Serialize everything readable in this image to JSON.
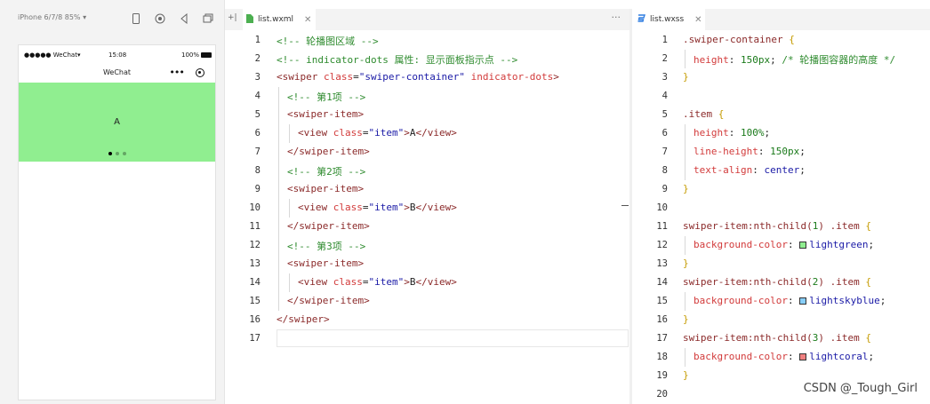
{
  "simulator": {
    "device_label": "iPhone 6/7/8 85% ▾",
    "toolbar_icons": [
      "phone-icon",
      "record-icon",
      "back-icon",
      "window-icon",
      "split-icon"
    ],
    "status": {
      "carrier": "●●●●● WeChat▾",
      "time": "15:08",
      "battery": "100%"
    },
    "nav_title": "WeChat",
    "capsule_dots": "•••",
    "swiper": {
      "current_item": "A",
      "background": "#90ee90",
      "dots_total": 3,
      "dots_active": 1
    }
  },
  "editor_wxml": {
    "split_label": "+|",
    "tab_label": "list.wxml",
    "more_label": "···",
    "lines": [
      {
        "n": "1",
        "indent": 0,
        "parts": [
          [
            "c-comment",
            "<!-- 轮播图区域 -->"
          ]
        ]
      },
      {
        "n": "2",
        "indent": 0,
        "parts": [
          [
            "c-comment",
            "<!-- indicator-dots 属性: 显示面板指示点 -->"
          ]
        ]
      },
      {
        "n": "3",
        "indent": 0,
        "parts": [
          [
            "c-tag",
            "<swiper "
          ],
          [
            "c-attr",
            "class"
          ],
          [
            "c-plain",
            "="
          ],
          [
            "c-str",
            "\"swiper-container\""
          ],
          [
            "c-plain",
            " "
          ],
          [
            "c-attr",
            "indicator-dots"
          ],
          [
            "c-tag",
            ">"
          ]
        ]
      },
      {
        "n": "4",
        "indent": 1,
        "parts": [
          [
            "c-comment",
            "<!-- 第1项 -->"
          ]
        ]
      },
      {
        "n": "5",
        "indent": 1,
        "parts": [
          [
            "c-tag",
            "<swiper-item>"
          ]
        ]
      },
      {
        "n": "6",
        "indent": 2,
        "parts": [
          [
            "c-tag",
            "<view "
          ],
          [
            "c-attr",
            "class"
          ],
          [
            "c-plain",
            "="
          ],
          [
            "c-str",
            "\"item\""
          ],
          [
            "c-tag",
            ">"
          ],
          [
            "c-plain",
            "A"
          ],
          [
            "c-tag",
            "</view>"
          ]
        ]
      },
      {
        "n": "7",
        "indent": 1,
        "parts": [
          [
            "c-tag",
            "</swiper-item>"
          ]
        ]
      },
      {
        "n": "8",
        "indent": 1,
        "parts": [
          [
            "c-comment",
            "<!-- 第2项 -->"
          ]
        ]
      },
      {
        "n": "9",
        "indent": 1,
        "parts": [
          [
            "c-tag",
            "<swiper-item>"
          ]
        ]
      },
      {
        "n": "10",
        "indent": 2,
        "parts": [
          [
            "c-tag",
            "<view "
          ],
          [
            "c-attr",
            "class"
          ],
          [
            "c-plain",
            "="
          ],
          [
            "c-str",
            "\"item\""
          ],
          [
            "c-tag",
            ">"
          ],
          [
            "c-plain",
            "B"
          ],
          [
            "c-tag",
            "</view>"
          ]
        ]
      },
      {
        "n": "11",
        "indent": 1,
        "parts": [
          [
            "c-tag",
            "</swiper-item>"
          ]
        ]
      },
      {
        "n": "12",
        "indent": 1,
        "parts": [
          [
            "c-comment",
            "<!-- 第3项 -->"
          ]
        ]
      },
      {
        "n": "13",
        "indent": 1,
        "parts": [
          [
            "c-tag",
            "<swiper-item>"
          ]
        ]
      },
      {
        "n": "14",
        "indent": 2,
        "parts": [
          [
            "c-tag",
            "<view "
          ],
          [
            "c-attr",
            "class"
          ],
          [
            "c-plain",
            "="
          ],
          [
            "c-str",
            "\"item\""
          ],
          [
            "c-tag",
            ">"
          ],
          [
            "c-plain",
            "B"
          ],
          [
            "c-tag",
            "</view>"
          ]
        ]
      },
      {
        "n": "15",
        "indent": 1,
        "parts": [
          [
            "c-tag",
            "</swiper-item>"
          ]
        ]
      },
      {
        "n": "16",
        "indent": 0,
        "parts": [
          [
            "c-tag",
            "</swiper>"
          ]
        ]
      },
      {
        "n": "17",
        "indent": 0,
        "parts": []
      }
    ]
  },
  "editor_wxss": {
    "tab_label": "list.wxss",
    "lines": [
      {
        "n": "1",
        "indent": 0,
        "parts": [
          [
            "c-sel",
            ".swiper-container "
          ],
          [
            "c-brace",
            "{"
          ]
        ]
      },
      {
        "n": "2",
        "indent": 1,
        "parts": [
          [
            "c-prop",
            "height"
          ],
          [
            "c-plain",
            ": "
          ],
          [
            "c-num",
            "150px"
          ],
          [
            "c-plain",
            "; "
          ],
          [
            "c-comment",
            "/* 轮播图容器的高度 */"
          ]
        ]
      },
      {
        "n": "3",
        "indent": 0,
        "parts": [
          [
            "c-brace",
            "}"
          ]
        ]
      },
      {
        "n": "4",
        "indent": 0,
        "parts": []
      },
      {
        "n": "5",
        "indent": 0,
        "parts": [
          [
            "c-sel",
            ".item "
          ],
          [
            "c-brace",
            "{"
          ]
        ]
      },
      {
        "n": "6",
        "indent": 1,
        "parts": [
          [
            "c-prop",
            "height"
          ],
          [
            "c-plain",
            ": "
          ],
          [
            "c-num",
            "100%"
          ],
          [
            "c-plain",
            ";"
          ]
        ]
      },
      {
        "n": "7",
        "indent": 1,
        "parts": [
          [
            "c-prop",
            "line-height"
          ],
          [
            "c-plain",
            ": "
          ],
          [
            "c-num",
            "150px"
          ],
          [
            "c-plain",
            ";"
          ]
        ]
      },
      {
        "n": "8",
        "indent": 1,
        "parts": [
          [
            "c-prop",
            "text-align"
          ],
          [
            "c-plain",
            ": "
          ],
          [
            "c-val",
            "center"
          ],
          [
            "c-plain",
            ";"
          ]
        ]
      },
      {
        "n": "9",
        "indent": 0,
        "parts": [
          [
            "c-brace",
            "}"
          ]
        ]
      },
      {
        "n": "10",
        "indent": 0,
        "parts": []
      },
      {
        "n": "11",
        "indent": 0,
        "parts": [
          [
            "c-sel",
            "swiper-item:nth-child("
          ],
          [
            "c-num",
            "1"
          ],
          [
            "c-sel",
            ") .item "
          ],
          [
            "c-brace",
            "{"
          ]
        ]
      },
      {
        "n": "12",
        "indent": 1,
        "parts": [
          [
            "c-prop",
            "background-color"
          ],
          [
            "c-plain",
            ": "
          ],
          [
            "swatch",
            "#90ee90"
          ],
          [
            "c-val",
            "lightgreen"
          ],
          [
            "c-plain",
            ";"
          ]
        ]
      },
      {
        "n": "13",
        "indent": 0,
        "parts": [
          [
            "c-brace",
            "}"
          ]
        ]
      },
      {
        "n": "14",
        "indent": 0,
        "parts": [
          [
            "c-sel",
            "swiper-item:nth-child("
          ],
          [
            "c-num",
            "2"
          ],
          [
            "c-sel",
            ") .item "
          ],
          [
            "c-brace",
            "{"
          ]
        ]
      },
      {
        "n": "15",
        "indent": 1,
        "parts": [
          [
            "c-prop",
            "background-color"
          ],
          [
            "c-plain",
            ": "
          ],
          [
            "swatch",
            "#87cefa"
          ],
          [
            "c-val",
            "lightskyblue"
          ],
          [
            "c-plain",
            ";"
          ]
        ]
      },
      {
        "n": "16",
        "indent": 0,
        "parts": [
          [
            "c-brace",
            "}"
          ]
        ]
      },
      {
        "n": "17",
        "indent": 0,
        "parts": [
          [
            "c-sel",
            "swiper-item:nth-child("
          ],
          [
            "c-num",
            "3"
          ],
          [
            "c-sel",
            ") .item "
          ],
          [
            "c-brace",
            "{"
          ]
        ]
      },
      {
        "n": "18",
        "indent": 1,
        "parts": [
          [
            "c-prop",
            "background-color"
          ],
          [
            "c-plain",
            ": "
          ],
          [
            "swatch",
            "#f08080"
          ],
          [
            "c-val",
            "lightcoral"
          ],
          [
            "c-plain",
            ";"
          ]
        ]
      },
      {
        "n": "19",
        "indent": 0,
        "parts": [
          [
            "c-brace",
            "}"
          ]
        ]
      },
      {
        "n": "20",
        "indent": 0,
        "parts": []
      }
    ]
  },
  "watermark": "CSDN @_Tough_Girl"
}
